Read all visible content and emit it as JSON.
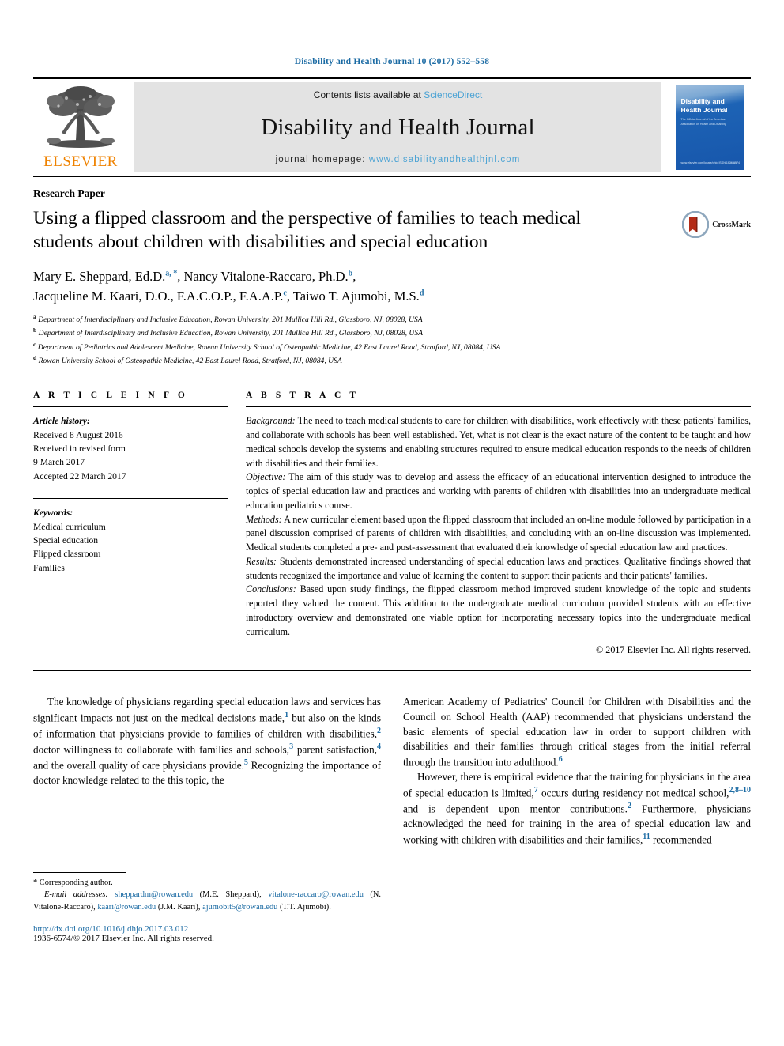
{
  "running_head": "Disability and Health Journal 10 (2017) 552–558",
  "masthead": {
    "publisher_name": "ELSEVIER",
    "contents_prefix": "Contents lists available at ",
    "contents_link": "ScienceDirect",
    "journal_title": "Disability and Health Journal",
    "homepage_prefix": "journal homepage: ",
    "homepage_url": "www.disabilityandhealthjnl.com",
    "cover": {
      "title_line1": "Disability and",
      "title_line2": "Health Journal",
      "subtitle": "The Official Journal of the\nAmerican Association on Health and Disability",
      "bottom_left": "www.elsevier.com/locate/dhjo\nISSN 1936-6574",
      "bottom_right": "ELSEVIER"
    }
  },
  "article": {
    "doctype": "Research Paper",
    "title": "Using a flipped classroom and the perspective of families to teach medical students about children with disabilities and special education",
    "crossmark_label": "CrossMark",
    "authors_line1_a": "Mary E. Sheppard, Ed.D.",
    "authors_line1_a_sup": "a, *",
    "authors_line1_b": ", Nancy Vitalone-Raccaro, Ph.D.",
    "authors_line1_b_sup": "b",
    "authors_line1_tail": ",",
    "authors_line2_a": "Jacqueline M. Kaari, D.O., F.A.C.O.P., F.A.A.P.",
    "authors_line2_a_sup": "c",
    "authors_line2_b": ", Taiwo T. Ajumobi, M.S.",
    "authors_line2_b_sup": "d",
    "affiliations": [
      {
        "mark": "a",
        "text": "Department of Interdisciplinary and Inclusive Education, Rowan University, 201 Mullica Hill Rd., Glassboro, NJ, 08028, USA"
      },
      {
        "mark": "b",
        "text": "Department of Interdisciplinary and Inclusive Education, Rowan University, 201 Mullica Hill Rd., Glassboro, NJ, 08028, USA"
      },
      {
        "mark": "c",
        "text": "Department of Pediatrics and Adolescent Medicine, Rowan University School of Osteopathic Medicine, 42 East Laurel Road, Stratford, NJ, 08084, USA"
      },
      {
        "mark": "d",
        "text": "Rowan University School of Osteopathic Medicine, 42 East Laurel Road, Stratford, NJ, 08084, USA"
      }
    ]
  },
  "article_info": {
    "heading": "A R T I C L E  I N F O",
    "history_label": "Article history:",
    "history_lines": [
      "Received 8 August 2016",
      "Received in revised form",
      "9 March 2017",
      "Accepted 22 March 2017"
    ],
    "keywords_label": "Keywords:",
    "keywords": [
      "Medical curriculum",
      "Special education",
      "Flipped classroom",
      "Families"
    ]
  },
  "abstract": {
    "heading": "A B S T R A C T",
    "sections": [
      {
        "label": "Background:",
        "text": " The need to teach medical students to care for children with disabilities, work effectively with these patients' families, and collaborate with schools has been well established. Yet, what is not clear is the exact nature of the content to be taught and how medical schools develop the systems and enabling structures required to ensure medical education responds to the needs of children with disabilities and their families."
      },
      {
        "label": "Objective:",
        "text": " The aim of this study was to develop and assess the efficacy of an educational intervention designed to introduce the topics of special education law and practices and working with parents of children with disabilities into an undergraduate medical education pediatrics course."
      },
      {
        "label": "Methods:",
        "text": " A new curricular element based upon the flipped classroom that included an on-line module followed by participation in a panel discussion comprised of parents of children with disabilities, and concluding with an on-line discussion was implemented. Medical students completed a pre- and post-assessment that evaluated their knowledge of special education law and practices."
      },
      {
        "label": "Results:",
        "text": " Students demonstrated increased understanding of special education laws and practices. Qualitative findings showed that students recognized the importance and value of learning the content to support their patients and their patients' families."
      },
      {
        "label": "Conclusions:",
        "text": " Based upon study findings, the flipped classroom method improved student knowledge of the topic and students reported they valued the content. This addition to the undergraduate medical curriculum provided students with an effective introductory overview and demonstrated one viable option for incorporating necessary topics into the undergraduate medical curriculum."
      }
    ],
    "copyright": "© 2017 Elsevier Inc. All rights reserved."
  },
  "body": {
    "left_paragraph_parts": [
      "The knowledge of physicians regarding special education laws and services has significant impacts not just on the medical decisions made,",
      "1",
      " but also on the kinds of information that physicians provide to families of children with disabilities,",
      "2",
      " doctor willingness to collaborate with families and schools,",
      "3",
      " parent satisfaction,",
      "4",
      " and the overall quality of care physicians provide.",
      "5",
      " Recognizing the importance of doctor knowledge related to the this topic, the"
    ],
    "right_paragraph1_parts": [
      "American Academy of Pediatrics' Council for Children with Disabilities and the Council on School Health (AAP) recommended that physicians understand the basic elements of special education law in order to support children with disabilities and their families through critical stages from the initial referral through the transition into adulthood.",
      "6"
    ],
    "right_paragraph2_parts": [
      "However, there is empirical evidence that the training for physicians in the area of special education is limited,",
      "7",
      " occurs during residency not medical school,",
      "2,8–10",
      " and is dependent upon mentor contributions.",
      "2",
      " Furthermore, physicians acknowledged the need for training in the area of special education law and working with children with disabilities and their families,",
      "11",
      " recommended"
    ]
  },
  "footnotes": {
    "corresponding": "* Corresponding author.",
    "email_label": "E-mail addresses:",
    "emails": [
      {
        "address": "sheppardm@rowan.edu",
        "name": " (M.E. Sheppard), "
      },
      {
        "address": "vitalone-raccaro@rowan.edu",
        "name": " (N. Vitalone-Raccaro), "
      },
      {
        "address": "kaari@rowan.edu",
        "name": " (J.M. Kaari), "
      },
      {
        "address": "ajumobit5@rowan.edu",
        "name": " (T.T. Ajumobi)."
      }
    ],
    "doi": "http://dx.doi.org/10.1016/j.dhjo.2017.03.012",
    "issn": "1936-6574/© 2017 Elsevier Inc. All rights reserved."
  },
  "colors": {
    "link_blue": "#1a6aa3",
    "sciencedirect_blue": "#4ca3d4",
    "elsevier_orange": "#ef8200",
    "band_gray": "#e3e3e3"
  }
}
